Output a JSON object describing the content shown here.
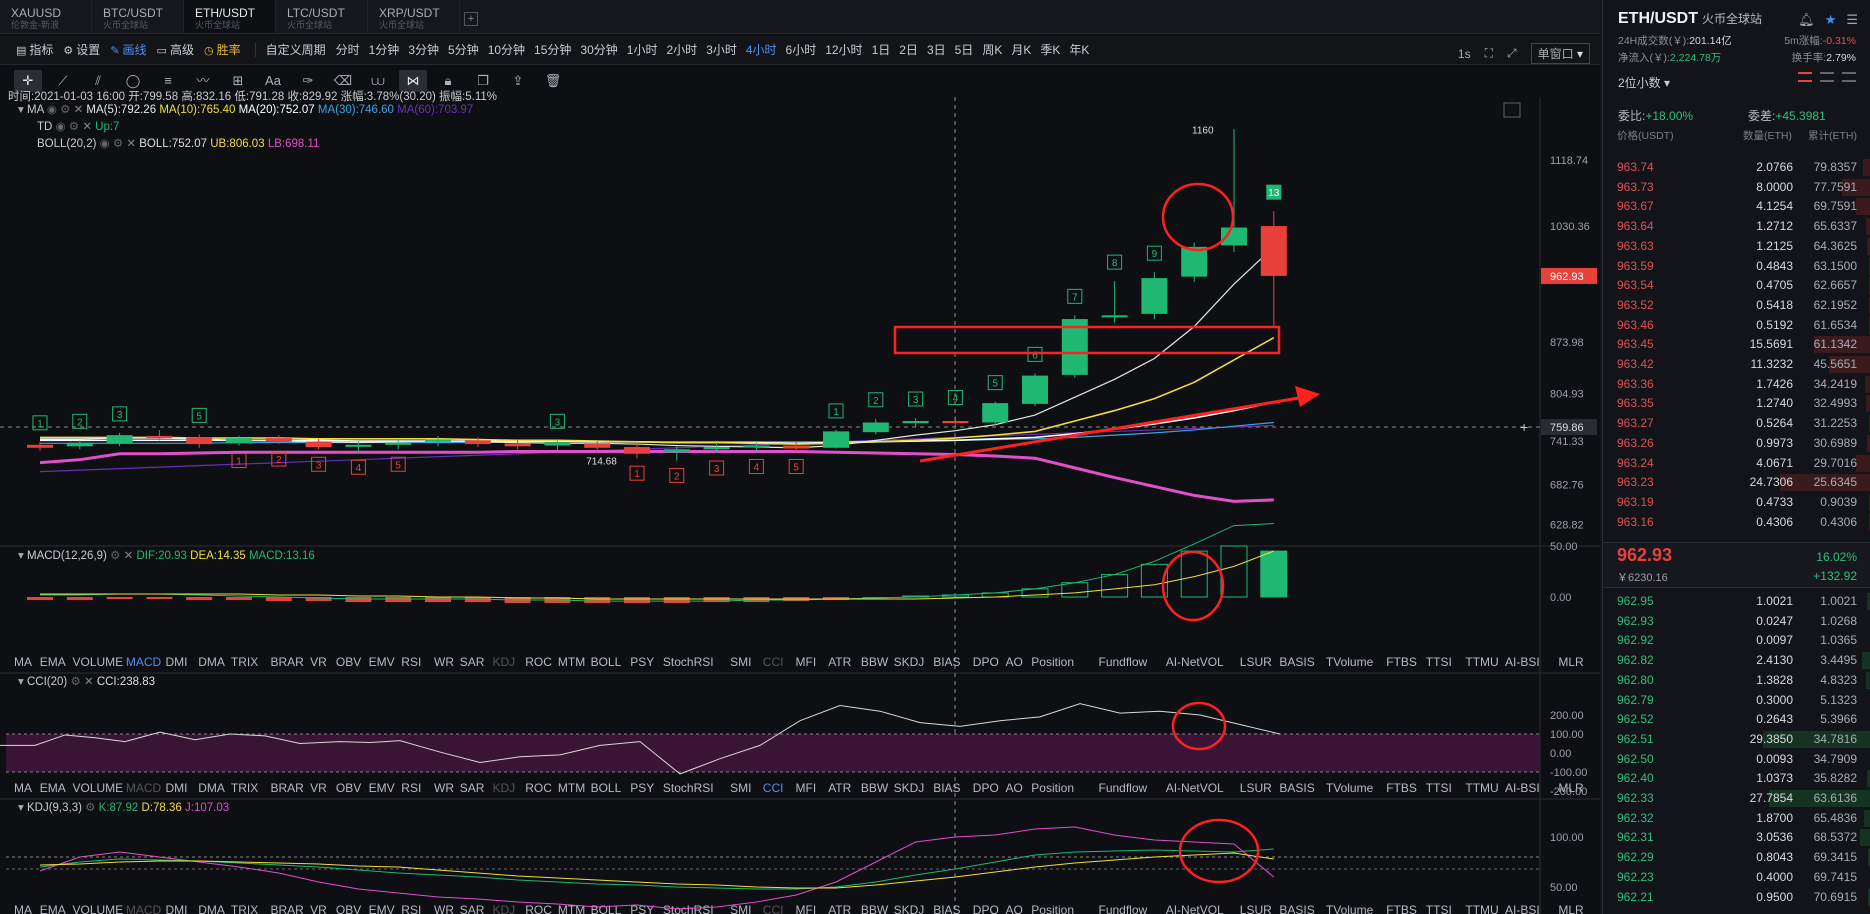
{
  "tabs": [
    {
      "label": "XAUUSD",
      "sub": "伦敦金-新浪"
    },
    {
      "label": "BTC/USDT",
      "sub": "火币全球站"
    },
    {
      "label": "ETH/USDT",
      "sub": "火币全球站"
    },
    {
      "label": "LTC/USDT",
      "sub": "火币全球站"
    },
    {
      "label": "XRP/USDT",
      "sub": "火币全球站"
    }
  ],
  "active_tab": 2,
  "add_tab": "+",
  "toolbar": {
    "indicator": "指标",
    "settings": "设置",
    "draw": "画线",
    "advanced": "高级",
    "winrate": "胜率",
    "custom_period": "自定义周期",
    "periods": [
      "分时",
      "1分钟",
      "3分钟",
      "5分钟",
      "10分钟",
      "15分钟",
      "30分钟",
      "1小时",
      "2小时",
      "3小时",
      "4小时",
      "6小时",
      "12小时",
      "1日",
      "2日",
      "3日",
      "5日",
      "周K",
      "月K",
      "季K",
      "年K"
    ],
    "active_period": "4小时",
    "interval": "1s",
    "window": "单窗口"
  },
  "draw_tools": [
    "crosshair",
    "line",
    "parallel",
    "ellipse",
    "fib",
    "wave",
    "measure",
    "text",
    "brush",
    "eraser",
    "magnet",
    "pattern",
    "lock",
    "copy",
    "share",
    "delete"
  ],
  "ohlc": {
    "time_label": "时间:",
    "time": "2021-01-03 16:00",
    "open_label": "开:",
    "open": "799.58",
    "high_label": "高:",
    "high": "832.16",
    "low_label": "低:",
    "low": "791.28",
    "close_label": "收:",
    "close": "829.92",
    "chg_label": "涨幅:",
    "chg": "3.78%(30.20)",
    "amp_label": "振幅:",
    "amp": "5.11%"
  },
  "main_legend": {
    "ma_name": "MA",
    "ma5": "MA(5):792.26",
    "ma10": "MA(10):765.40",
    "ma20": "MA(20):752.07",
    "ma30": "MA(30):746.60",
    "ma60": "MA(60):703.97",
    "td_name": "TD",
    "td_val": "Up:7",
    "boll_name": "BOLL(20,2)",
    "boll": "BOLL:752.07",
    "ub": "UB:806.03",
    "lb": "LB:698.11"
  },
  "macd_legend": {
    "name": "MACD(12,26,9)",
    "dif": "DIF:20.93",
    "dea": "DEA:14.35",
    "macd": "MACD:13.16"
  },
  "cci_legend": {
    "name": "CCI(20)",
    "cci": "CCI:238.83"
  },
  "kdj_legend": {
    "name": "KDJ(9,3,3)",
    "k": "K:87.92",
    "d": "D:78.36",
    "j": "J:107.03"
  },
  "indicator_tabs": [
    "MA",
    "EMA",
    "VOLUME",
    "MACD",
    "DMI",
    "DMA",
    "TRIX",
    "BRAR",
    "VR",
    "OBV",
    "EMV",
    "RSI",
    "WR",
    "SAR",
    "KDJ",
    "ROC",
    "MTM",
    "BOLL",
    "PSY",
    "StochRSI",
    "SMI",
    "CCI",
    "MFI",
    "ATR",
    "BBW",
    "SKDJ",
    "BIAS",
    "DPO",
    "AO",
    "Position",
    "Fundflow",
    "AI-NetVOL",
    "LSUR",
    "BASIS",
    "TVolume",
    "FTBS",
    "TTSI",
    "TTMU",
    "AI-BSI",
    "MLR"
  ],
  "main_axis": [
    "1118.74",
    "1030.36",
    "873.98",
    "804.93",
    "741.33",
    "682.76",
    "628.82"
  ],
  "current_price_tag": "962.93",
  "crosshair_price": "759.86",
  "crosshair_plus": "+",
  "macd_axis": [
    "50.00",
    "0.00"
  ],
  "cci_axis": [
    "200.00",
    "100.00",
    "0.00",
    "-100.00",
    "-200.00"
  ],
  "kdj_axis": [
    "100.00",
    "50.00"
  ],
  "annotations": {
    "high": "1160",
    "low": "714.68",
    "td_last": "13"
  },
  "chart_data": {
    "type": "candlestick",
    "candles": [
      {
        "o": 736,
        "h": 740,
        "l": 728,
        "c": 732
      },
      {
        "o": 734,
        "h": 742,
        "l": 730,
        "c": 739
      },
      {
        "o": 738,
        "h": 752,
        "l": 734,
        "c": 749
      },
      {
        "o": 748,
        "h": 756,
        "l": 742,
        "c": 745
      },
      {
        "o": 746,
        "h": 750,
        "l": 732,
        "c": 737
      },
      {
        "o": 738,
        "h": 748,
        "l": 735,
        "c": 745
      },
      {
        "o": 745,
        "h": 749,
        "l": 737,
        "c": 740
      },
      {
        "o": 740,
        "h": 744,
        "l": 730,
        "c": 733
      },
      {
        "o": 734,
        "h": 741,
        "l": 726,
        "c": 736
      },
      {
        "o": 736,
        "h": 744,
        "l": 730,
        "c": 739
      },
      {
        "o": 740,
        "h": 748,
        "l": 734,
        "c": 743
      },
      {
        "o": 742,
        "h": 746,
        "l": 733,
        "c": 737
      },
      {
        "o": 738,
        "h": 744,
        "l": 730,
        "c": 734
      },
      {
        "o": 735,
        "h": 742,
        "l": 729,
        "c": 739
      },
      {
        "o": 738,
        "h": 741,
        "l": 728,
        "c": 732
      },
      {
        "o": 733,
        "h": 737,
        "l": 718,
        "c": 724
      },
      {
        "o": 726,
        "h": 734,
        "l": 715,
        "c": 730
      },
      {
        "o": 730,
        "h": 737,
        "l": 725,
        "c": 733
      },
      {
        "o": 733,
        "h": 739,
        "l": 727,
        "c": 735
      },
      {
        "o": 735,
        "h": 740,
        "l": 727,
        "c": 731
      },
      {
        "o": 732,
        "h": 756,
        "l": 731,
        "c": 754
      },
      {
        "o": 753,
        "h": 771,
        "l": 750,
        "c": 766
      },
      {
        "o": 765,
        "h": 772,
        "l": 760,
        "c": 768
      },
      {
        "o": 768,
        "h": 774,
        "l": 763,
        "c": 765
      },
      {
        "o": 766,
        "h": 794,
        "l": 762,
        "c": 792
      },
      {
        "o": 791,
        "h": 832,
        "l": 788,
        "c": 829
      },
      {
        "o": 830,
        "h": 910,
        "l": 826,
        "c": 905
      },
      {
        "o": 908,
        "h": 956,
        "l": 900,
        "c": 910
      },
      {
        "o": 912,
        "h": 968,
        "l": 905,
        "c": 960
      },
      {
        "o": 962,
        "h": 1008,
        "l": 955,
        "c": 1002
      },
      {
        "o": 1004,
        "h": 1160,
        "l": 995,
        "c": 1028
      },
      {
        "o": 1030,
        "h": 1050,
        "l": 895,
        "c": 963
      }
    ],
    "ma_series": {
      "ma5": [
        744,
        744,
        745,
        745,
        744,
        742,
        741,
        740,
        739,
        740,
        741,
        740,
        739,
        738,
        738,
        737,
        735,
        734,
        733,
        732,
        735,
        742,
        749,
        755,
        763,
        776,
        800,
        824,
        852,
        895,
        952,
        1002
      ],
      "ma10": [
        746,
        746,
        746,
        746,
        745,
        745,
        745,
        744,
        744,
        744,
        744,
        743,
        742,
        742,
        741,
        740,
        739,
        739,
        738,
        737,
        738,
        740,
        742,
        745,
        749,
        754,
        768,
        782,
        798,
        820,
        850,
        880
      ],
      "ma20": [
        742,
        742,
        742,
        742,
        742,
        742,
        742,
        742,
        741,
        741,
        741,
        741,
        741,
        741,
        740,
        740,
        739,
        739,
        739,
        738,
        739,
        740,
        741,
        742,
        744,
        746,
        751,
        757,
        764,
        772,
        782,
        793
      ],
      "ma30": [
        738,
        738,
        738,
        738,
        738,
        739,
        739,
        739,
        739,
        739,
        739,
        739,
        740,
        740,
        740,
        740,
        740,
        740,
        740,
        740,
        740,
        741,
        741,
        742,
        743,
        744,
        746,
        749,
        752,
        756,
        761,
        766
      ],
      "ma60": [
        700,
        702,
        704,
        706,
        708,
        710,
        712,
        714,
        716,
        718,
        720,
        722,
        724,
        726,
        728,
        730,
        732,
        734,
        736,
        738,
        740,
        742,
        744,
        746,
        748,
        750,
        752,
        754,
        756,
        758,
        760,
        762
      ],
      "lb": [
        712,
        716,
        724,
        724,
        725,
        726,
        726,
        726,
        726,
        726,
        726,
        726,
        727,
        727,
        727,
        727,
        727,
        727,
        727,
        727,
        726,
        725,
        724,
        723,
        721,
        718,
        705,
        692,
        680,
        668,
        660,
        662
      ]
    },
    "td_up": [
      [
        0,
        "1"
      ],
      [
        1,
        "2"
      ],
      [
        2,
        "3"
      ],
      [
        4,
        "5"
      ],
      [
        13,
        "3"
      ],
      [
        20,
        "1"
      ],
      [
        21,
        "2"
      ],
      [
        22,
        "3"
      ],
      [
        23,
        "4"
      ],
      [
        24,
        "5"
      ],
      [
        25,
        "6"
      ],
      [
        26,
        "7"
      ],
      [
        27,
        "8"
      ],
      [
        28,
        "9"
      ],
      [
        31,
        "13"
      ]
    ],
    "td_down": [
      [
        5,
        "1"
      ],
      [
        6,
        "2"
      ],
      [
        7,
        "3"
      ],
      [
        8,
        "4"
      ],
      [
        9,
        "5"
      ],
      [
        15,
        "1"
      ],
      [
        16,
        "2"
      ],
      [
        17,
        "3"
      ],
      [
        18,
        "4"
      ],
      [
        19,
        "5"
      ]
    ],
    "macd": {
      "hist": [
        -3,
        -3,
        -2,
        -2,
        -3,
        -3,
        -4,
        -4,
        -5,
        -5,
        -5,
        -5,
        -6,
        -6,
        -6,
        -6,
        -6,
        -5,
        -5,
        -4,
        -3,
        -1,
        1,
        2,
        4,
        8,
        14,
        22,
        32,
        45,
        50,
        45
      ],
      "dif": [
        2,
        2,
        3,
        3,
        2,
        1,
        0,
        -1,
        -2,
        -2,
        -2,
        -2,
        -3,
        -3,
        -4,
        -4,
        -4,
        -4,
        -3,
        -3,
        -2,
        -1,
        0,
        2,
        4,
        8,
        14,
        22,
        35,
        52,
        70,
        72
      ],
      "dea": [
        3,
        3,
        3,
        3,
        3,
        3,
        2,
        2,
        1,
        1,
        0,
        0,
        -1,
        -1,
        -2,
        -2,
        -2,
        -2,
        -2,
        -2,
        -2,
        -2,
        -2,
        -1,
        0,
        2,
        4,
        8,
        12,
        20,
        30,
        45
      ]
    },
    "cci": [
      40,
      40,
      95,
      80,
      60,
      110,
      70,
      100,
      90,
      50,
      60,
      55,
      65,
      5,
      -50,
      -20,
      -10,
      40,
      60,
      -110,
      -30,
      40,
      170,
      250,
      220,
      160,
      140,
      170,
      190,
      260,
      210,
      220,
      200,
      150,
      100
    ],
    "cci_x": [
      0,
      35,
      65,
      95,
      125,
      160,
      195,
      230,
      265,
      300,
      340,
      370,
      400,
      440,
      480,
      520,
      560,
      600,
      640,
      680,
      720,
      760,
      800,
      840,
      880,
      920,
      960,
      1000,
      1040,
      1080,
      1120,
      1160,
      1200,
      1240,
      1280
    ],
    "kdj": {
      "k": [
        70,
        75,
        78,
        77,
        76,
        74,
        72,
        70,
        67,
        64,
        62,
        60,
        57,
        55,
        53,
        52,
        50,
        49,
        48,
        48,
        50,
        55,
        62,
        68,
        75,
        82,
        85,
        86,
        87,
        86,
        85,
        88
      ],
      "d": [
        72,
        73,
        75,
        76,
        76,
        75,
        74,
        73,
        71,
        70,
        67,
        64,
        61,
        59,
        57,
        55,
        53,
        52,
        50,
        49,
        49,
        52,
        56,
        60,
        65,
        70,
        74,
        77,
        80,
        82,
        84,
        78
      ],
      "j": [
        66,
        80,
        85,
        80,
        75,
        70,
        64,
        55,
        48,
        44,
        40,
        38,
        35,
        33,
        30,
        32,
        28,
        30,
        35,
        42,
        55,
        75,
        95,
        100,
        102,
        108,
        110,
        102,
        97,
        95,
        93,
        60
      ]
    }
  },
  "orderbook": {
    "symbol": "ETH/USDT",
    "exchange": "火币全球站",
    "vol_label": "24H成交数(￥):",
    "vol": "201.14亿",
    "m5_label": "5m涨幅:",
    "m5": "-0.31%",
    "inflow_label": "净流入(￥):",
    "inflow": "2,224.78万",
    "turnover_label": "换手率:",
    "turnover": "2.79%",
    "decimals": "2位小数",
    "ratio_label": "委比:",
    "ratio": "+18.00%",
    "diff_label": "委差:",
    "diff": "+45.3981",
    "col_price": "价格(USDT)",
    "col_qty": "数量(ETH)",
    "col_total": "累计(ETH)",
    "asks": [
      [
        "963.74",
        "2.0766",
        "79.8357"
      ],
      [
        "963.73",
        "8.0000",
        "77.7591"
      ],
      [
        "963.67",
        "4.1254",
        "69.7591"
      ],
      [
        "963.64",
        "1.2712",
        "65.6337"
      ],
      [
        "963.63",
        "1.2125",
        "64.3625"
      ],
      [
        "963.59",
        "0.4843",
        "63.1500"
      ],
      [
        "963.54",
        "0.4705",
        "62.6657"
      ],
      [
        "963.52",
        "0.5418",
        "62.1952"
      ],
      [
        "963.46",
        "0.5192",
        "61.6534"
      ],
      [
        "963.45",
        "15.5691",
        "61.1342"
      ],
      [
        "963.42",
        "11.3232",
        "45.5651"
      ],
      [
        "963.36",
        "1.7426",
        "34.2419"
      ],
      [
        "963.35",
        "1.2740",
        "32.4993"
      ],
      [
        "963.27",
        "0.5264",
        "31.2253"
      ],
      [
        "963.26",
        "0.9973",
        "30.6989"
      ],
      [
        "963.24",
        "4.0671",
        "29.7016"
      ],
      [
        "963.23",
        "24.7306",
        "25.6345"
      ],
      [
        "963.19",
        "0.4733",
        "0.9039"
      ],
      [
        "963.16",
        "0.4306",
        "0.4306"
      ]
    ],
    "bids": [
      [
        "962.95",
        "1.0021",
        "1.0021"
      ],
      [
        "962.93",
        "0.0247",
        "1.0268"
      ],
      [
        "962.92",
        "0.0097",
        "1.0365"
      ],
      [
        "962.82",
        "2.4130",
        "3.4495"
      ],
      [
        "962.80",
        "1.3828",
        "4.8323"
      ],
      [
        "962.79",
        "0.3000",
        "5.1323"
      ],
      [
        "962.52",
        "0.2643",
        "5.3966"
      ],
      [
        "962.51",
        "29.3850",
        "34.7816"
      ],
      [
        "962.50",
        "0.0093",
        "34.7909"
      ],
      [
        "962.40",
        "1.0373",
        "35.8282"
      ],
      [
        "962.33",
        "27.7854",
        "63.6136"
      ],
      [
        "962.32",
        "1.8700",
        "65.4836"
      ],
      [
        "962.31",
        "3.0536",
        "68.5372"
      ],
      [
        "962.29",
        "0.8043",
        "69.3415"
      ],
      [
        "962.23",
        "0.4000",
        "69.7415"
      ],
      [
        "962.21",
        "0.9500",
        "70.6915"
      ]
    ],
    "last": "962.93",
    "last_cny": "￥6230.16",
    "chg_pct": "16.02%",
    "chg_abs": "+132.92"
  },
  "colors": {
    "up": "#1fb873",
    "down": "#e8413b",
    "ma5": "#e6e6e6",
    "ma10": "#f0de3c",
    "ma20": "#ffffff",
    "ma30": "#3aa5e0",
    "ma60": "#6a2fb5",
    "lb": "#e050c8",
    "annot": "#ff2020"
  }
}
